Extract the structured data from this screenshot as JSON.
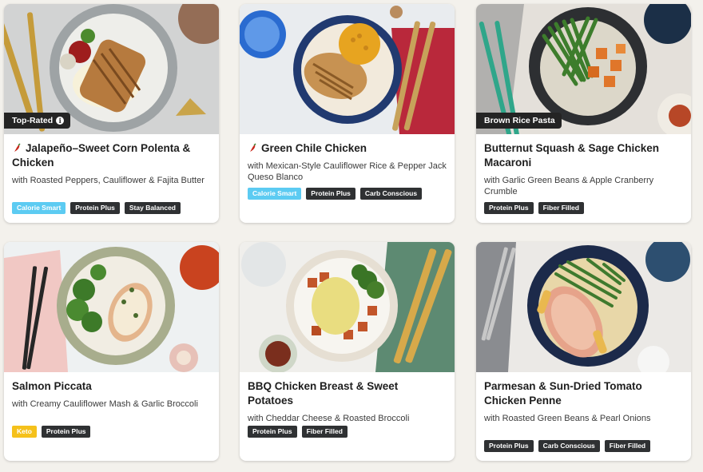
{
  "colors": {
    "page_bg": "#f3f1ec",
    "tag_dark": "#2f3133",
    "tag_calorie": "#5ccbf2",
    "tag_keto": "#f5c11b",
    "chili": "#c8261b"
  },
  "cards": [
    {
      "badge": "Top-Rated",
      "title": "Jalapeño–Sweet Corn Polenta & Chicken",
      "subtitle": "with Roasted Peppers, Cauliflower & Fajita Butter",
      "tags": [
        "Calorie Smart",
        "Protein Plus",
        "Stay Balanced"
      ],
      "spicy": true
    },
    {
      "title": "Green Chile Chicken",
      "subtitle": "with Mexican-Style Cauliflower Rice & Pepper Jack Queso Blanco",
      "tags": [
        "Calorie Smart",
        "Protein Plus",
        "Carb Conscious"
      ],
      "spicy": true
    },
    {
      "badge": "Brown Rice Pasta",
      "title": "Butternut Squash & Sage Chicken Macaroni",
      "subtitle": "with Garlic Green Beans & Apple Cranberry Crumble",
      "tags": [
        "Protein Plus",
        "Fiber Filled"
      ]
    },
    {
      "title": "Salmon Piccata",
      "subtitle": "with Creamy Cauliflower Mash & Garlic Broccoli",
      "tags": [
        "Keto",
        "Protein Plus"
      ]
    },
    {
      "title": "BBQ Chicken Breast & Sweet Potatoes",
      "subtitle": "with Cheddar Cheese & Roasted Broccoli",
      "tags": [
        "Protein Plus",
        "Fiber Filled"
      ]
    },
    {
      "title": "Parmesan & Sun-Dried Tomato Chicken Penne",
      "subtitle": "with Roasted Green Beans & Pearl Onions",
      "tags": [
        "Protein Plus",
        "Carb Conscious",
        "Fiber Filled"
      ]
    }
  ]
}
